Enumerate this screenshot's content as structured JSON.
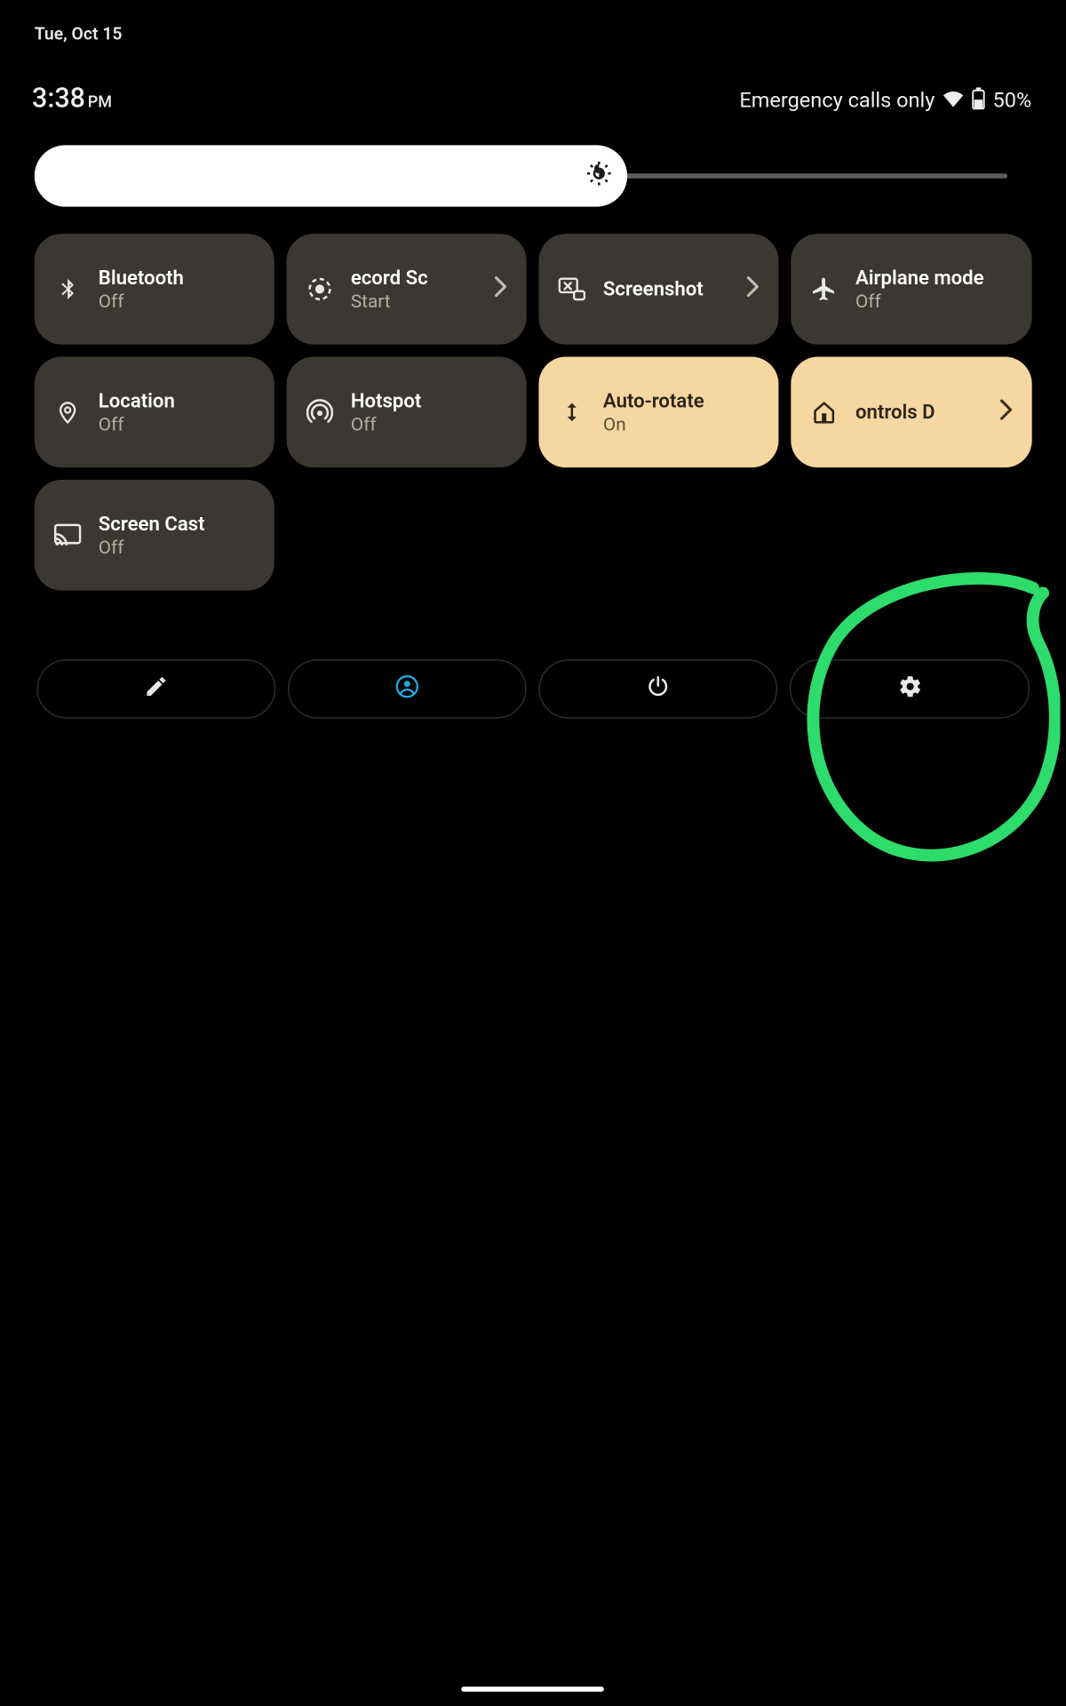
{
  "status": {
    "date": "Tue, Oct 15",
    "time": "3:38",
    "ampm": "PM",
    "emergency": "Emergency calls only",
    "battery_pct": "50%"
  },
  "brightness": {
    "fill_percent": 61
  },
  "tiles": [
    {
      "id": "bluetooth",
      "title": "Bluetooth",
      "sub": "Off",
      "icon": "bluetooth",
      "on": false,
      "chevron": false
    },
    {
      "id": "record",
      "title": "ecord       Sc",
      "sub": "Start",
      "icon": "record",
      "on": false,
      "chevron": true
    },
    {
      "id": "screenshot",
      "title": "Screenshot",
      "sub": "",
      "icon": "screenshot",
      "on": false,
      "chevron": true
    },
    {
      "id": "airplane",
      "title": "Airplane mode",
      "sub": "Off",
      "icon": "airplane",
      "on": false,
      "chevron": false
    },
    {
      "id": "location",
      "title": "Location",
      "sub": "Off",
      "icon": "location",
      "on": false,
      "chevron": false
    },
    {
      "id": "hotspot",
      "title": "Hotspot",
      "sub": "Off",
      "icon": "hotspot",
      "on": false,
      "chevron": false
    },
    {
      "id": "autorotate",
      "title": "Auto-rotate",
      "sub": "On",
      "icon": "autorotate",
      "on": true,
      "chevron": false
    },
    {
      "id": "homecontrols",
      "title": "ontrols        D",
      "sub": "",
      "icon": "home",
      "on": true,
      "chevron": true
    },
    {
      "id": "screencast",
      "title": "Screen Cast",
      "sub": "Off",
      "icon": "cast",
      "on": false,
      "chevron": false
    }
  ],
  "icons": {
    "bluetooth": "bluetooth-icon",
    "record": "screen-record-icon",
    "screenshot": "screenshot-icon",
    "airplane": "airplane-icon",
    "location": "location-pin-icon",
    "hotspot": "hotspot-icon",
    "autorotate": "auto-rotate-icon",
    "home": "home-icon",
    "cast": "cast-icon"
  },
  "bottom_buttons": {
    "edit": "edit-button",
    "user": "user-switch-button",
    "power": "power-button",
    "settings": "settings-button"
  },
  "annotation": {
    "highlights": "settings-button",
    "color": "#2ddc6b"
  }
}
